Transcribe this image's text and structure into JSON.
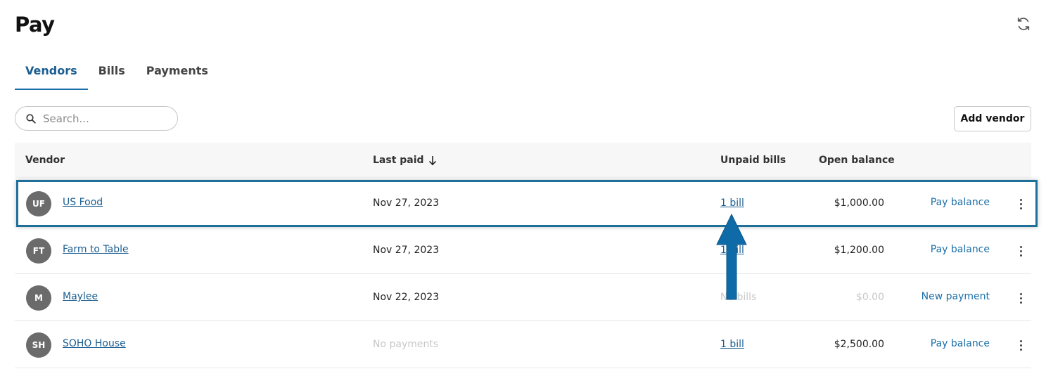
{
  "page": {
    "title": "Pay"
  },
  "tabs": [
    {
      "label": "Vendors",
      "active": true
    },
    {
      "label": "Bills",
      "active": false
    },
    {
      "label": "Payments",
      "active": false
    }
  ],
  "search": {
    "placeholder": "Search...",
    "value": ""
  },
  "toolbar": {
    "add_vendor_label": "Add vendor",
    "refresh_icon": "refresh-icon"
  },
  "table": {
    "headers": {
      "vendor": "Vendor",
      "last_paid": "Last paid",
      "unpaid_bills": "Unpaid bills",
      "open_balance": "Open balance"
    },
    "sort": {
      "column": "last_paid",
      "direction": "descending",
      "icon": "arrow-down-icon"
    },
    "rows": [
      {
        "initials": "UF",
        "name": "US Food",
        "last_paid": "Nov 27, 2023",
        "unpaid_bills": "1 bill",
        "open_balance": "$1,000.00",
        "action": "Pay balance"
      },
      {
        "initials": "FT",
        "name": "Farm to Table",
        "last_paid": "Nov 27, 2023",
        "unpaid_bills": "1 bill",
        "open_balance": "$1,200.00",
        "action": "Pay balance"
      },
      {
        "initials": "M",
        "name": "Maylee",
        "last_paid": "Nov 22, 2023",
        "unpaid_bills": "No bills",
        "open_balance": "$0.00",
        "action": "New payment"
      },
      {
        "initials": "SH",
        "name": "SOHO House",
        "last_paid": "No payments",
        "unpaid_bills": "1 bill",
        "open_balance": "$2,500.00",
        "action": "Pay balance"
      }
    ]
  },
  "colors": {
    "accent": "#1b6fa8",
    "link": "#1b5e91",
    "avatar": "#6b6b6b",
    "highlight": "#1f6f9b",
    "arrow": "#0f6ba8"
  }
}
